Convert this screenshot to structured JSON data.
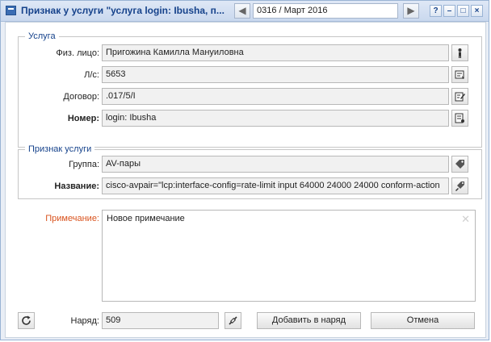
{
  "window": {
    "title": "Признак у услуги \"услуга login: Ibusha, п...",
    "period": "0316 / Март 2016",
    "prev_icon": "triangle-left",
    "next_icon": "triangle-right",
    "help_label": "?",
    "minimize_label": "–",
    "maximize_label": "□",
    "close_label": "×"
  },
  "service": {
    "legend": "Услуга",
    "person_label": "Физ. лицо:",
    "person_value": "Пригожина Камилла Мануиловна",
    "account_label": "Л/с:",
    "account_value": "5653",
    "contract_label": "Договор:",
    "contract_value": ".017/5/I",
    "number_label": "Номер:",
    "number_value": "login: Ibusha"
  },
  "attribute": {
    "legend": "Признак услуги",
    "group_label": "Группа:",
    "group_value": "AV-пары",
    "name_label": "Название:",
    "name_value": "cisco-avpair=\"lcp:interface-config=rate-limit input 64000 24000 24000 conform-action"
  },
  "note": {
    "label": "Примечание:",
    "value": "Новое примечание"
  },
  "footer": {
    "order_label": "Наряд:",
    "order_value": "509",
    "add_button": "Добавить в наряд",
    "cancel_button": "Отмена"
  },
  "colors": {
    "title": "#15428b",
    "required_label": "#d9531e",
    "frame": "#99b3d4"
  }
}
